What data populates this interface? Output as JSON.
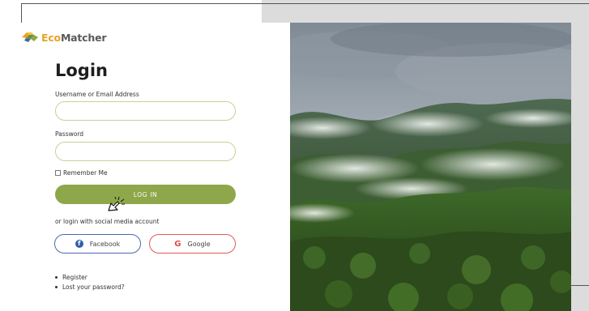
{
  "brand": {
    "eco": "Eco",
    "matcher": "Matcher"
  },
  "login": {
    "title": "Login",
    "username_label": "Username or Email Address",
    "username_value": "",
    "password_label": "Password",
    "password_value": "",
    "remember_label": "Remember Me",
    "remember_checked": false,
    "submit_label": "LOG IN",
    "social_label": "or login with social media account",
    "facebook_label": "Facebook",
    "google_label": "Google",
    "google_glyph": "G",
    "facebook_glyph": "f"
  },
  "links": [
    {
      "label": "Register"
    },
    {
      "label": "Lost your password?"
    }
  ],
  "colors": {
    "accent_green": "#8ea74a",
    "input_border": "#c8cf9a",
    "facebook_blue": "#4b69b0",
    "google_red": "#e05a57",
    "brand_orange": "#e8a323"
  },
  "icons": {
    "logo": "ecomatcher-logo-icon",
    "cursor": "pointer-click-icon",
    "facebook": "facebook-icon",
    "google": "google-icon"
  }
}
